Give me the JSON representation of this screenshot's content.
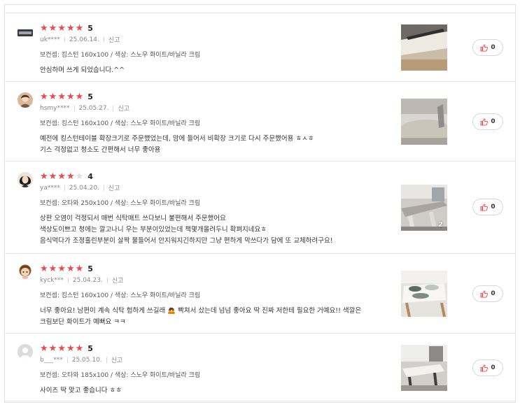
{
  "colors": {
    "star": "#e94b4b",
    "star_empty": "#dddddd",
    "like_icon": "#e94b4b",
    "border": "#e6e6e6"
  },
  "star_max": 5,
  "reviews": [
    {
      "rating": 5,
      "score": "5",
      "user": "uk****",
      "date": "25.06.14.",
      "report": "신고",
      "option": "보컨셉: 킹스턴 160x100 / 색상: 스노우 화이트/바닐라 크림",
      "lines": [
        "안심하며 쓰게 되었습니다.^^"
      ],
      "likes": "0",
      "photo_count": "",
      "avatar": "badge-avatar"
    },
    {
      "rating": 5,
      "score": "5",
      "user": "hsmy****",
      "date": "25.05.27.",
      "report": "신고",
      "option": "보컨셉: 킹스턴 160x100 / 색상: 스노우 화이트/바닐라 크림",
      "lines": [
        "예전에 킹스턴테이블 확장크기로 주문했었는데, 맘에 들어서 비확장 크기로 다시 주문했어용 ㅎㅅㅎ",
        "기스 걱정없고 청소도 간편해서 너무 좋아용"
      ],
      "likes": "0",
      "photo_count": "",
      "avatar": "photo-avatar"
    },
    {
      "rating": 4,
      "score": "4",
      "user": "ya****",
      "date": "25.04.20.",
      "report": "신고",
      "option": "보컨셉: 오타와 250x100 / 색상: 스노우 화이트/바닐라 크림",
      "lines": [
        "상판 오염이 걱정되서 매번 식탁매트 쓰다보니 불편해서 주문했어요",
        "색상도이쁘고 청에는 깔고나니 우는 부분이있었는데 책몇개올려두니 확펴지네요ㅎ",
        "음식먹다가 조정흘린부분이 살짝 물들어서 안지워지긴하지만 그냥 편하게 막쓰다가 담에 또 교체하려구요!"
      ],
      "likes": "0",
      "photo_count": "2",
      "avatar": "photo-avatar"
    },
    {
      "rating": 5,
      "score": "5",
      "user": "kyck***",
      "date": "25.04.23.",
      "report": "신고",
      "option": "보컨셉: 킹스턴 160x100 / 색상: 스노우 화이트/바닐라 크림",
      "lines": [
        "너무 좋아요! 남편이 계속 식탁 험하게 쓰길래 🙇 빡쳐서 샀는데 넘넘 좋아요 딱 진짜 저한테 필요한 거예요!! 색깔은",
        "크림보단 화이트가 예뻐요 ㅋㅋ"
      ],
      "likes": "0",
      "photo_count": "",
      "avatar": "character-avatar"
    },
    {
      "rating": 5,
      "score": "5",
      "user": "b___***",
      "date": "25.05.10.",
      "report": "신고",
      "option": "보컨셉: 오타와 185x100 / 색상: 스노우 화이트/바닐라 크림",
      "lines": [
        "사이즈 딱 맞고 좋습니다 ㅎㅎ"
      ],
      "likes": "0",
      "photo_count": "",
      "avatar": "default-avatar"
    }
  ]
}
